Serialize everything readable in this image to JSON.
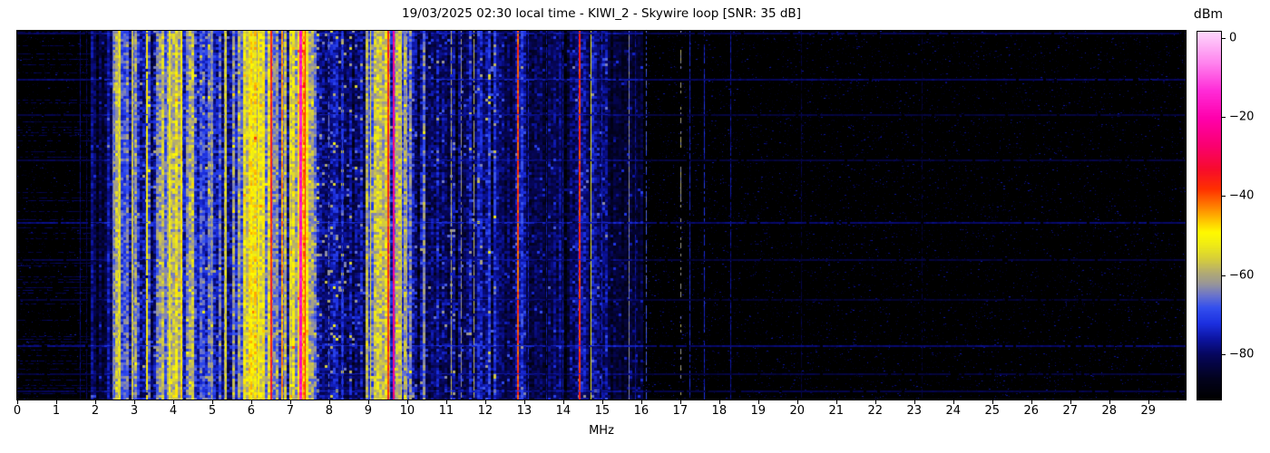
{
  "title": "19/03/2025 02:30 local time - KIWI_2 - Skywire loop [SNR: 35 dB]",
  "x_axis": {
    "label": "MHz",
    "ticks": [
      0,
      1,
      2,
      3,
      4,
      5,
      6,
      7,
      8,
      9,
      10,
      11,
      12,
      13,
      14,
      15,
      16,
      17,
      18,
      19,
      20,
      21,
      22,
      23,
      24,
      25,
      26,
      27,
      28,
      29
    ]
  },
  "colorbar": {
    "label": "dBm",
    "ticks": [
      0,
      -20,
      -40,
      -60,
      -80
    ],
    "tick_labels": [
      "0",
      "−20",
      "−40",
      "−60",
      "−80"
    ]
  },
  "chart_data": {
    "type": "heatmap",
    "title": "19/03/2025 02:30 local time - KIWI_2 - Skywire loop [SNR: 35 dB]",
    "xlabel": "MHz",
    "ylabel": "",
    "x_range": [
      0,
      29.96
    ],
    "value_range_dbm": [
      -91.2,
      1.8
    ],
    "colorbar_label": "dBm",
    "colorbar_ticks_dbm": [
      0,
      -20,
      -40,
      -60,
      -80
    ],
    "legend": "none",
    "grid": false,
    "description": "HF waterfall spectrogram 0-30 MHz; time on vertical axis; strong broadcast/ham activity 2.5-10.5 MHz; brightest carrier near 7.27 MHz; quiet noise floor above 16 MHz with sporadic time streaks",
    "seed": 1337,
    "colormap_stops": [
      [
        -91.2,
        0,
        0,
        0
      ],
      [
        -86,
        2,
        2,
        30
      ],
      [
        -80,
        6,
        6,
        92
      ],
      [
        -76,
        12,
        20,
        160
      ],
      [
        -72,
        28,
        48,
        225
      ],
      [
        -68,
        52,
        80,
        238
      ],
      [
        -65,
        105,
        115,
        205
      ],
      [
        -62,
        152,
        150,
        152
      ],
      [
        -59,
        180,
        172,
        112
      ],
      [
        -56,
        212,
        204,
        62
      ],
      [
        -52,
        240,
        236,
        20
      ],
      [
        -49,
        255,
        250,
        0
      ],
      [
        -46,
        255,
        196,
        0
      ],
      [
        -42,
        255,
        120,
        0
      ],
      [
        -38,
        255,
        48,
        0
      ],
      [
        -33,
        247,
        12,
        44
      ],
      [
        -27,
        250,
        0,
        112
      ],
      [
        -20,
        255,
        0,
        172
      ],
      [
        -13,
        255,
        44,
        216
      ],
      [
        -6,
        255,
        132,
        238
      ],
      [
        1.8,
        253,
        215,
        252
      ]
    ],
    "bands": [
      {
        "f0": 0.0,
        "f1": 1.9,
        "level": -88,
        "col_var": 1,
        "cell_var": 2,
        "gap_p": 0,
        "gap_db": 0,
        "spike_p": 0.06,
        "spike_db": 8,
        "floor": true,
        "dash_rows": true
      },
      {
        "f0": 1.9,
        "f1": 2.45,
        "level": -79,
        "col_var": 4,
        "cell_var": 4,
        "gap_p": 0.25,
        "gap_db": 6,
        "spike_p": 0.02,
        "spike_db": 8
      },
      {
        "f0": 2.45,
        "f1": 3.1,
        "level": -63,
        "col_var": 8,
        "cell_var": 6,
        "gap_p": 0.3,
        "gap_db": 13,
        "spike_p": 0.03,
        "spike_db": 6
      },
      {
        "f0": 3.1,
        "f1": 3.55,
        "level": -72,
        "col_var": 6,
        "cell_var": 6,
        "gap_p": 0.25,
        "gap_db": 8,
        "spike_p": 0.05,
        "spike_db": 10
      },
      {
        "f0": 3.55,
        "f1": 4.05,
        "level": -61,
        "col_var": 7,
        "cell_var": 6,
        "gap_p": 0.28,
        "gap_db": 13,
        "spike_p": 0.03,
        "spike_db": 6
      },
      {
        "f0": 4.05,
        "f1": 4.55,
        "level": -59,
        "col_var": 6,
        "cell_var": 6,
        "gap_p": 0.22,
        "gap_db": 13,
        "spike_p": 0.03,
        "spike_db": 6
      },
      {
        "f0": 4.55,
        "f1": 5.25,
        "level": -70,
        "col_var": 7,
        "cell_var": 6,
        "gap_p": 0.3,
        "gap_db": 9,
        "spike_p": 0.05,
        "spike_db": 9
      },
      {
        "f0": 5.25,
        "f1": 5.8,
        "level": -65,
        "col_var": 7,
        "cell_var": 6,
        "gap_p": 0.3,
        "gap_db": 11,
        "spike_p": 0.04,
        "spike_db": 7
      },
      {
        "f0": 5.8,
        "f1": 6.35,
        "level": -56,
        "col_var": 6,
        "cell_var": 6,
        "gap_p": 0.2,
        "gap_db": 12,
        "spike_p": 0.03,
        "spike_db": 5
      },
      {
        "f0": 6.35,
        "f1": 7.18,
        "level": -61,
        "col_var": 8,
        "cell_var": 6,
        "gap_p": 0.28,
        "gap_db": 13,
        "spike_p": 0.04,
        "spike_db": 7
      },
      {
        "f0": 7.18,
        "f1": 7.45,
        "level": -50,
        "col_var": 6,
        "cell_var": 5,
        "gap_p": 0.1,
        "gap_db": 8,
        "spike_p": 0.05,
        "spike_db": 6
      },
      {
        "f0": 7.45,
        "f1": 7.68,
        "level": -59,
        "col_var": 6,
        "cell_var": 6,
        "gap_p": 0.2,
        "gap_db": 10,
        "spike_p": 0.04,
        "spike_db": 6
      },
      {
        "f0": 7.68,
        "f1": 8.85,
        "level": -77,
        "col_var": 4,
        "cell_var": 5,
        "gap_p": 0.2,
        "gap_db": 5,
        "spike_p": 0.07,
        "spike_db": 15
      },
      {
        "f0": 8.85,
        "f1": 9.95,
        "level": -62,
        "col_var": 8,
        "cell_var": 6,
        "gap_p": 0.3,
        "gap_db": 12,
        "spike_p": 0.04,
        "spike_db": 7
      },
      {
        "f0": 9.95,
        "f1": 10.45,
        "level": -69,
        "col_var": 7,
        "cell_var": 6,
        "gap_p": 0.3,
        "gap_db": 9,
        "spike_p": 0.05,
        "spike_db": 9
      },
      {
        "f0": 10.45,
        "f1": 11.55,
        "level": -79,
        "col_var": 4,
        "cell_var": 5,
        "gap_p": 0.2,
        "gap_db": 5,
        "spike_p": 0.05,
        "spike_db": 11
      },
      {
        "f0": 11.55,
        "f1": 12.3,
        "level": -76,
        "col_var": 5,
        "cell_var": 5,
        "gap_p": 0.2,
        "gap_db": 6,
        "spike_p": 0.06,
        "spike_db": 12
      },
      {
        "f0": 12.3,
        "f1": 12.78,
        "level": -81,
        "col_var": 3,
        "cell_var": 4,
        "gap_p": 0.2,
        "gap_db": 4,
        "spike_p": 0.04,
        "spike_db": 8
      },
      {
        "f0": 12.78,
        "f1": 13.05,
        "level": -73,
        "col_var": 5,
        "cell_var": 5,
        "gap_p": 0.2,
        "gap_db": 6,
        "spike_p": 0.05,
        "spike_db": 8
      },
      {
        "f0": 13.05,
        "f1": 14.25,
        "level": -81,
        "col_var": 4,
        "cell_var": 4,
        "gap_p": 0.25,
        "gap_db": 5,
        "spike_p": 0.04,
        "spike_db": 8
      },
      {
        "f0": 14.25,
        "f1": 15.15,
        "level": -79,
        "col_var": 4,
        "cell_var": 5,
        "gap_p": 0.25,
        "gap_db": 5,
        "spike_p": 0.04,
        "spike_db": 9
      },
      {
        "f0": 15.15,
        "f1": 16.05,
        "level": -85,
        "col_var": 2,
        "cell_var": 3,
        "gap_p": 0,
        "gap_db": 0,
        "spike_p": 0.06,
        "spike_db": 8
      },
      {
        "f0": 16.05,
        "f1": 29.96,
        "level": -89,
        "col_var": 1,
        "cell_var": 2,
        "gap_p": 0,
        "gap_db": 0,
        "spike_p": 0.16,
        "spike_db": 8,
        "floor": true
      }
    ],
    "carriers": [
      {
        "f": 1.62,
        "level": -80,
        "w": 1,
        "p": 1
      },
      {
        "f": 1.78,
        "level": -82,
        "w": 1,
        "p": 0.9
      },
      {
        "f": 2.45,
        "level": -64,
        "w": 1,
        "p": 0.9
      },
      {
        "f": 2.62,
        "level": -54,
        "w": 2,
        "p": 1
      },
      {
        "f": 2.95,
        "level": -57,
        "w": 2,
        "p": 1
      },
      {
        "f": 3.33,
        "level": -50,
        "w": 2,
        "p": 0.95
      },
      {
        "f": 3.9,
        "level": -52,
        "w": 2,
        "p": 1
      },
      {
        "f": 4.2,
        "level": -49,
        "w": 2,
        "p": 1
      },
      {
        "f": 5.0,
        "level": -60,
        "w": 1,
        "p": 0.9
      },
      {
        "f": 5.35,
        "level": -55,
        "w": 2,
        "p": 1
      },
      {
        "f": 6.0,
        "level": -48,
        "w": 2,
        "p": 1
      },
      {
        "f": 6.18,
        "level": -50,
        "w": 2,
        "p": 1
      },
      {
        "f": 6.52,
        "level": -36,
        "w": 2,
        "p": 1
      },
      {
        "f": 6.8,
        "level": -44,
        "w": 2,
        "p": 1
      },
      {
        "f": 7.0,
        "level": -50,
        "w": 1,
        "p": 1
      },
      {
        "f": 7.27,
        "level": -17,
        "w": 3,
        "p": 1
      },
      {
        "f": 7.38,
        "level": -37,
        "w": 1,
        "p": 1
      },
      {
        "f": 8.0,
        "level": -66,
        "w": 1,
        "p": 0.5
      },
      {
        "f": 8.35,
        "level": -70,
        "w": 1,
        "p": 0.5
      },
      {
        "f": 9.05,
        "level": -50,
        "w": 1,
        "p": 1
      },
      {
        "f": 9.51,
        "level": -37,
        "w": 2,
        "p": 1
      },
      {
        "f": 9.66,
        "level": -24,
        "w": 2,
        "p": 1
      },
      {
        "f": 9.85,
        "level": -55,
        "w": 1,
        "p": 1
      },
      {
        "f": 10.0,
        "level": -60,
        "w": 1,
        "p": 0.9
      },
      {
        "f": 11.14,
        "level": -58,
        "w": 1,
        "p": 0.85
      },
      {
        "f": 11.39,
        "level": -62,
        "w": 1,
        "p": 0.8
      },
      {
        "f": 11.72,
        "level": -58,
        "w": 1,
        "p": 0.85
      },
      {
        "f": 12.85,
        "level": -39,
        "w": 2,
        "p": 1
      },
      {
        "f": 13.1,
        "level": -74,
        "w": 1,
        "p": 0.9
      },
      {
        "f": 13.58,
        "level": -76,
        "w": 1,
        "p": 0.9
      },
      {
        "f": 14.0,
        "level": -76,
        "w": 1,
        "p": 0.9
      },
      {
        "f": 14.42,
        "level": -37,
        "w": 2,
        "p": 1
      },
      {
        "f": 14.72,
        "level": -53,
        "w": 1,
        "p": 1
      },
      {
        "f": 15.0,
        "level": -74,
        "w": 1,
        "p": 0.8
      },
      {
        "f": 15.7,
        "level": -63,
        "w": 1,
        "p": 1
      },
      {
        "f": 15.85,
        "level": -77,
        "w": 1,
        "p": 0.9
      },
      {
        "f": 16.12,
        "level": -68,
        "w": 1,
        "p": 0.55
      },
      {
        "f": 17.02,
        "level": -61,
        "w": 1,
        "p": 0.5
      },
      {
        "f": 17.25,
        "level": -75,
        "w": 1,
        "p": 0.9
      },
      {
        "f": 17.62,
        "level": -73,
        "w": 1,
        "p": 0.8
      },
      {
        "f": 18.3,
        "level": -77,
        "w": 1,
        "p": 0.9
      },
      {
        "f": 20.1,
        "level": -83,
        "w": 1,
        "p": 0.8
      },
      {
        "f": 23.2,
        "level": -84,
        "w": 1,
        "p": 0.6
      }
    ],
    "time_streaks": [
      {
        "y": 0.004,
        "amp": 7
      },
      {
        "y": 0.131,
        "amp": 8
      },
      {
        "y": 0.227,
        "amp": 5
      },
      {
        "y": 0.35,
        "amp": 5
      },
      {
        "y": 0.519,
        "amp": 9
      },
      {
        "y": 0.62,
        "amp": 5
      },
      {
        "y": 0.727,
        "amp": 4
      },
      {
        "y": 0.853,
        "amp": 9
      },
      {
        "y": 0.928,
        "amp": 5
      },
      {
        "y": 0.975,
        "amp": 6
      }
    ]
  }
}
